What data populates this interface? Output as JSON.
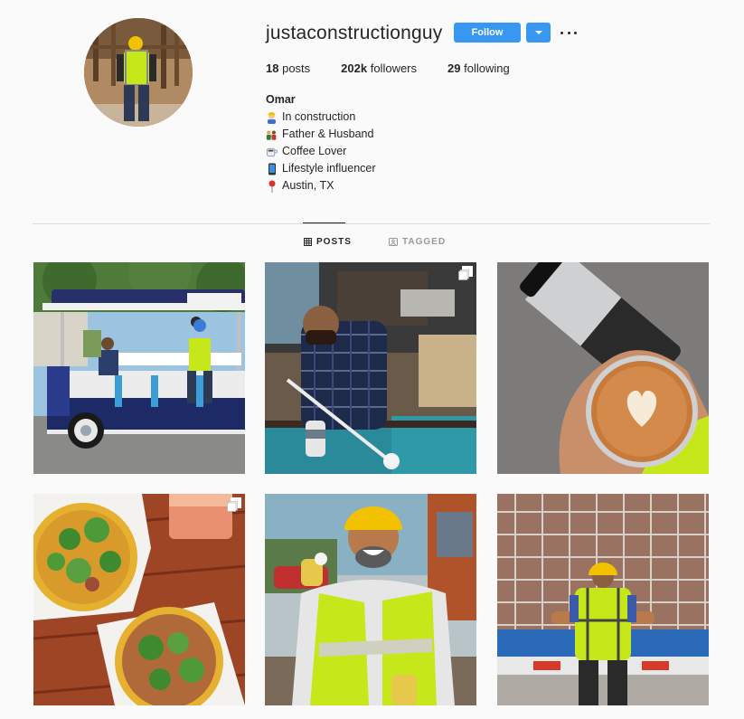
{
  "profile": {
    "username": "justaconstructionguy",
    "follow_label": "Follow",
    "posts_count": "18",
    "posts_label": "posts",
    "followers_count": "202k",
    "followers_label": "followers",
    "following_count": "29",
    "following_label": "following",
    "name": "Omar",
    "bio": [
      {
        "icon": "construction-worker-icon",
        "text": "In construction"
      },
      {
        "icon": "family-icon",
        "text": "Father & Husband"
      },
      {
        "icon": "coffee-icon",
        "text": "Coffee Lover"
      },
      {
        "icon": "phone-icon",
        "text": "Lifestyle influencer"
      },
      {
        "icon": "pin-icon",
        "text": "Austin, TX"
      }
    ]
  },
  "tabs": {
    "posts": "POSTS",
    "tagged": "TAGGED"
  },
  "posts": [
    {
      "subject": "party bike with hipsider sign"
    },
    {
      "subject": "man playing pool"
    },
    {
      "subject": "coffee latte and thermos"
    },
    {
      "subject": "tacos on wooden table"
    },
    {
      "subject": "laughing worker in safety vest"
    },
    {
      "subject": "worker facing scaffolding building"
    }
  ],
  "colors": {
    "accent": "#3897f0",
    "text": "#262626",
    "muted": "#999999",
    "background": "#fafafa"
  }
}
